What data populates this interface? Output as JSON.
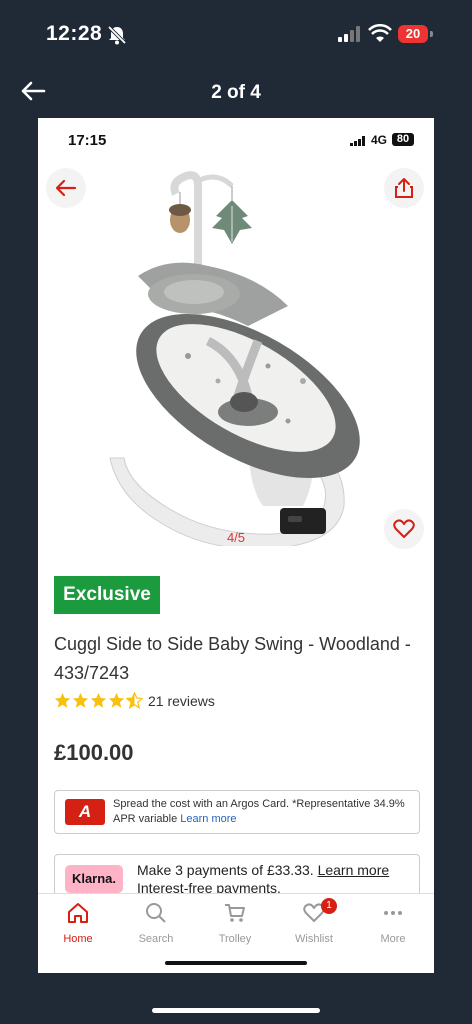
{
  "status_bar": {
    "time": "12:28",
    "battery": "20"
  },
  "viewer": {
    "counter": "2 of 4"
  },
  "inner_status": {
    "time": "17:15",
    "network": "4G",
    "battery": "80"
  },
  "product": {
    "image_counter": "4/5",
    "badge": "Exclusive",
    "title": "Cuggl Side to Side Baby Swing - Woodland - 433/7243",
    "rating": 4.5,
    "reviews": "21 reviews",
    "price": "£100.00"
  },
  "argos_card": {
    "logo": "A",
    "text": "Spread the cost with an Argos Card. *Representative 34.9% APR variable ",
    "link": "Learn more"
  },
  "klarna": {
    "logo": "Klarna.",
    "text": "Make 3 payments of £33.33. ",
    "link": "Learn more",
    "subtext": "Interest-free payments."
  },
  "nav": {
    "items": [
      {
        "label": "Home",
        "icon": "home-icon",
        "active": true
      },
      {
        "label": "Search",
        "icon": "search-icon"
      },
      {
        "label": "Trolley",
        "icon": "trolley-icon"
      },
      {
        "label": "Wishlist",
        "icon": "heart-icon",
        "badge": "1"
      },
      {
        "label": "More",
        "icon": "more-icon"
      }
    ]
  },
  "colors": {
    "brand_red": "#d42114",
    "exclusive_green": "#1c9a3e",
    "background": "#1f2a36"
  }
}
